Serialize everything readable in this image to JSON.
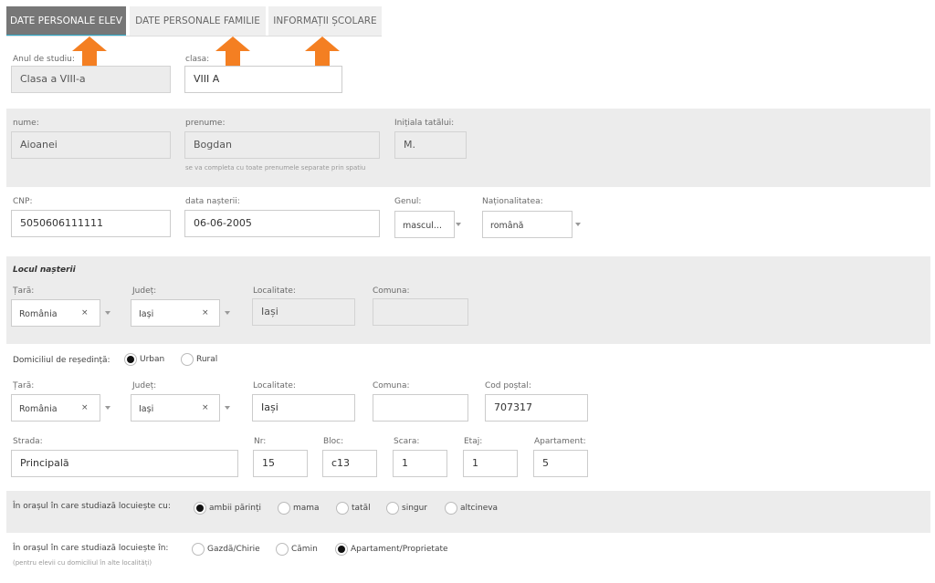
{
  "tabs": [
    {
      "label": "DATE PERSONALE ELEV",
      "active": true
    },
    {
      "label": "DATE PERSONALE FAMILIE",
      "active": false
    },
    {
      "label": "INFORMAȚII ȘCOLARE",
      "active": false
    }
  ],
  "colors": {
    "accent_arrow": "#f47f22",
    "active_tab_bg": "#777777",
    "active_tab_underline": "#2aa9c9",
    "band_bg": "#ececec"
  },
  "study": {
    "year_label": "Anul de studiu:",
    "year_value": "Clasa a VIII-a",
    "class_label": "clasa:",
    "class_value": "VIII A"
  },
  "identity": {
    "lastname_label": "nume:",
    "lastname_value": "Aioanei",
    "firstname_label": "prenume:",
    "firstname_value": "Bogdan",
    "firstname_hint": "se va completa cu toate prenumele separate prin spatiu",
    "father_initial_label": "Inițiala tatălui:",
    "father_initial_value": "M."
  },
  "details": {
    "cnp_label": "CNP:",
    "cnp_value": "5050606111111",
    "birthdate_label": "data nașterii:",
    "birthdate_value": "06-06-2005",
    "gender_label": "Genul:",
    "gender_value": "mascul...",
    "nationality_label": "Naționalitatea:",
    "nationality_value": "română"
  },
  "birthplace": {
    "title": "Locul nașterii",
    "country_label": "Țară:",
    "country_value": "România",
    "county_label": "Județ:",
    "county_value": "Iași",
    "locality_label": "Localitate:",
    "locality_value": "Iași",
    "commune_label": "Comuna:",
    "commune_value": ""
  },
  "residence": {
    "label": "Domiciliul de reședință:",
    "options": [
      {
        "label": "Urban",
        "selected": true
      },
      {
        "label": "Rural",
        "selected": false
      }
    ],
    "country_label": "Țară:",
    "country_value": "România",
    "county_label": "Județ:",
    "county_value": "Iași",
    "locality_label": "Localitate:",
    "locality_value": "Iași",
    "commune_label": "Comuna:",
    "commune_value": "",
    "postal_label": "Cod poștal:",
    "postal_value": "707317",
    "street_label": "Strada:",
    "street_value": "Principală",
    "number_label": "Nr:",
    "number_value": "15",
    "block_label": "Bloc:",
    "block_value": "c13",
    "stair_label": "Scara:",
    "stair_value": "1",
    "floor_label": "Etaj:",
    "floor_value": "1",
    "apartment_label": "Apartament:",
    "apartment_value": "5"
  },
  "lives_with": {
    "label": "În orașul în care studiază locuiește cu:",
    "options": [
      {
        "label": "ambii părinți",
        "selected": true
      },
      {
        "label": "mama",
        "selected": false
      },
      {
        "label": "tatăl",
        "selected": false
      },
      {
        "label": "singur",
        "selected": false
      },
      {
        "label": "altcineva",
        "selected": false
      }
    ]
  },
  "lives_in": {
    "label": "În orașul în care studiază locuiește în:",
    "hint": "(pentru elevii cu domiciliul în alte localități)",
    "options": [
      {
        "label": "Gazdă/Chirie",
        "selected": false
      },
      {
        "label": "Cămin",
        "selected": false
      },
      {
        "label": "Apartament/Proprietate",
        "selected": true
      }
    ]
  },
  "clear_symbol": "×"
}
